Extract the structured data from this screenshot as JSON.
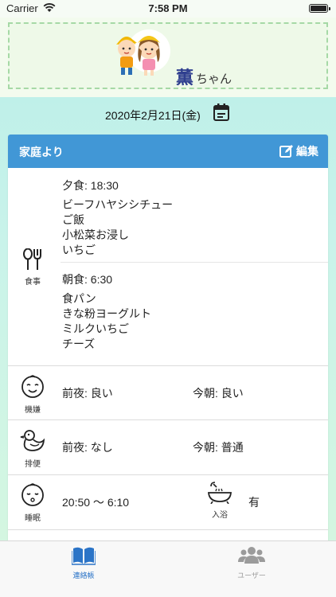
{
  "status_bar": {
    "carrier": "Carrier",
    "time": "7:58 PM"
  },
  "header": {
    "child_name": "薫",
    "name_suffix": "ちゃん"
  },
  "date": {
    "text": "2020年2月21日(金)"
  },
  "card": {
    "title": "家庭より",
    "edit_label": "編集",
    "meal": {
      "icon_label": "食事",
      "dinner_time": "夕食: 18:30",
      "dinner_items": [
        "ビーフハヤシシチュー",
        "ご飯",
        "小松菜お浸し",
        "いちご"
      ],
      "breakfast_time": "朝食: 6:30",
      "breakfast_items": [
        "食パン",
        "きな粉ヨーグルト",
        "ミルクいちご",
        "チーズ"
      ]
    },
    "mood": {
      "icon_label": "機嫌",
      "last_night": "前夜: 良い",
      "this_morning": "今朝: 良い"
    },
    "bowel": {
      "icon_label": "排便",
      "last_night": "前夜: なし",
      "this_morning": "今朝: 普通"
    },
    "sleep": {
      "icon_label": "睡眠",
      "time": "20:50 〜 6:10",
      "bath_label": "入浴",
      "bath_value": "有"
    }
  },
  "tabs": [
    {
      "label": "連絡帳",
      "active": true
    },
    {
      "label": "ユーザー",
      "active": false
    }
  ],
  "colors": {
    "accent": "#4197d6",
    "tab_active": "#2b74c7",
    "header_border": "#a6d9a6"
  }
}
